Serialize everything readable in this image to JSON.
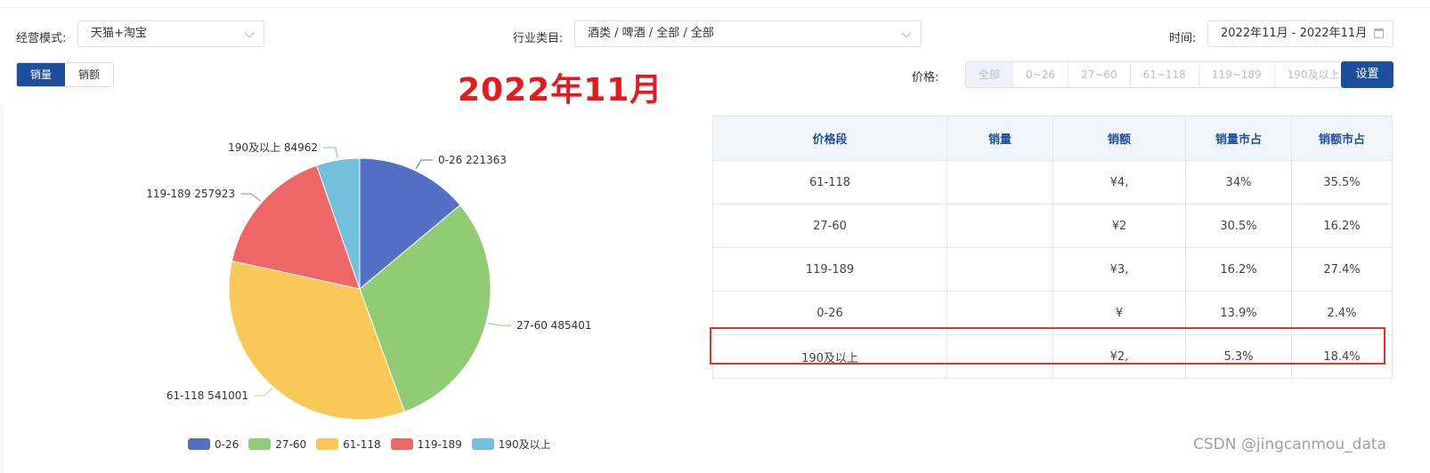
{
  "filters": {
    "mode_label": "经营模式:",
    "mode_value": "天猫+淘宝",
    "category_label": "行业类目:",
    "category_value": "酒类 / 啤酒 / 全部 / 全部",
    "time_label": "时间:",
    "time_value": "2022年11月 - 2022年11月"
  },
  "toggle": {
    "sales_volume": "销量",
    "sales_amount": "销额"
  },
  "headline": "2022年11月",
  "price": {
    "label": "价格:",
    "options": [
      "全部",
      "0~26",
      "27~60",
      "61~118",
      "119~189",
      "190及以上"
    ],
    "settings_button": "设置"
  },
  "colors": {
    "blue": "#5470c6",
    "green": "#91cc75",
    "yellow": "#fac858",
    "red": "#ee6666",
    "cyan": "#73c0de",
    "brand": "#1d4f9c",
    "highlight": "#e63325"
  },
  "chart_data": {
    "type": "pie",
    "categories": [
      "0-26",
      "27-60",
      "61-118",
      "119-189",
      "190及以上"
    ],
    "values": [
      221363,
      485401,
      541001,
      257923,
      84962
    ],
    "slice_labels": [
      "0-26   221363",
      "27-60   485401",
      "61-118   541001",
      "119-189   257923",
      "190及以上   84962"
    ],
    "legend": [
      "0-26",
      "27-60",
      "61-118",
      "119-189",
      "190及以上"
    ],
    "legend_position": "bottom",
    "colors": [
      "#5470c6",
      "#91cc75",
      "#fac858",
      "#ee6666",
      "#73c0de"
    ]
  },
  "table": {
    "headers": [
      "价格段",
      "销量",
      "销额",
      "销量市占",
      "销额市占"
    ],
    "rows": [
      [
        "61-118",
        "",
        "¥4,",
        "34%",
        "35.5%"
      ],
      [
        "27-60",
        "",
        "¥2",
        "30.5%",
        "16.2%"
      ],
      [
        "119-189",
        "",
        "¥3,",
        "16.2%",
        "27.4%"
      ],
      [
        "0-26",
        "",
        "¥",
        "13.9%",
        "2.4%"
      ],
      [
        "190及以上",
        "",
        "¥2,",
        "5.3%",
        "18.4%"
      ]
    ],
    "highlighted_row": "190及以上"
  },
  "watermark": "CSDN @jingcanmou_data"
}
